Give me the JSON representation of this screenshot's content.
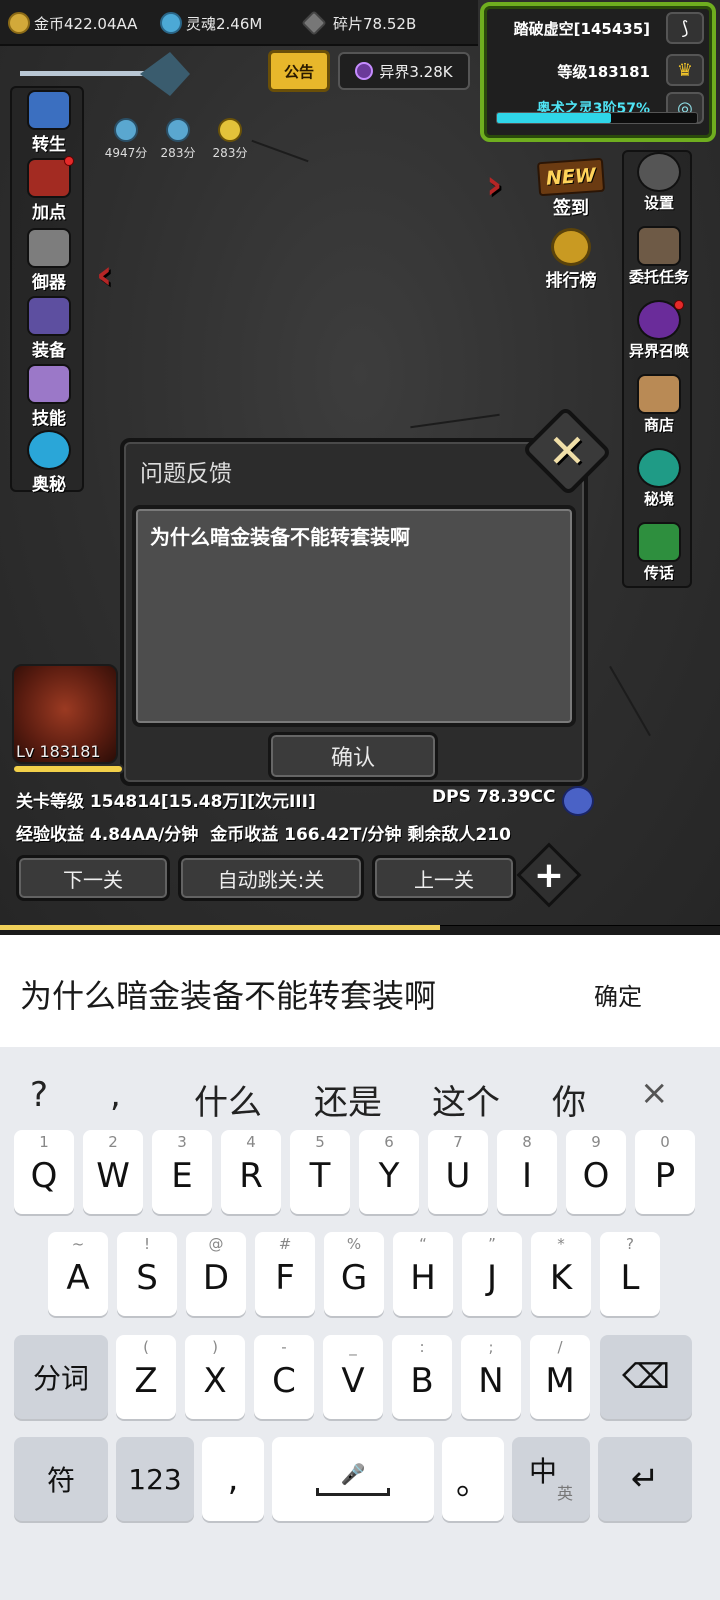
{
  "resources": {
    "gold": "金币422.04AA",
    "soul": "灵魂2.46M",
    "shard": "碎片78.52B"
  },
  "player": {
    "name": "踏破虚空[145435]",
    "level": "等级183181",
    "arcane": "奥术之灵3阶57%",
    "arcane_progress": 0.57
  },
  "top": {
    "notice": "公告",
    "otherworld": "异界3.28K"
  },
  "buffs": [
    "4947分",
    "283分",
    "283分"
  ],
  "left_menu": [
    "转生",
    "加点",
    "御器",
    "装备",
    "技能",
    "奥秘"
  ],
  "right_menu": [
    "设置",
    "委托任务",
    "异界召唤",
    "商店",
    "秘境",
    "传话"
  ],
  "checkin": {
    "tag": "NEW",
    "label": "签到"
  },
  "ranking": "排行榜",
  "dialog": {
    "title": "问题反馈",
    "text": "为什么暗金装备不能转套装啊",
    "confirm": "确认"
  },
  "hero": {
    "level": "Lv 183181"
  },
  "stats": {
    "stage": "关卡等级 154814[15.48万][次元III]",
    "dps": "DPS 78.39CC",
    "income": "经验收益 4.84AA/分钟  金币收益 166.42T/分钟 剩余敌人210"
  },
  "buttons": {
    "next": "下一关",
    "auto_skip": "自动跳关:关",
    "prev": "上一关",
    "plus": "+"
  },
  "ime": {
    "text": "为什么暗金装备不能转套装啊",
    "confirm": "确定",
    "candidates": [
      "?",
      ",",
      "什么",
      "还是",
      "这个",
      "你"
    ],
    "close": "×"
  },
  "keyboard": {
    "row1": [
      {
        "k": "Q",
        "h": "1"
      },
      {
        "k": "W",
        "h": "2"
      },
      {
        "k": "E",
        "h": "3"
      },
      {
        "k": "R",
        "h": "4"
      },
      {
        "k": "T",
        "h": "5"
      },
      {
        "k": "Y",
        "h": "6"
      },
      {
        "k": "U",
        "h": "7"
      },
      {
        "k": "I",
        "h": "8"
      },
      {
        "k": "O",
        "h": "9"
      },
      {
        "k": "P",
        "h": "0"
      }
    ],
    "row2": [
      {
        "k": "A",
        "h": "~"
      },
      {
        "k": "S",
        "h": "!"
      },
      {
        "k": "D",
        "h": "@"
      },
      {
        "k": "F",
        "h": "#"
      },
      {
        "k": "G",
        "h": "%"
      },
      {
        "k": "H",
        "h": "“"
      },
      {
        "k": "J",
        "h": "”"
      },
      {
        "k": "K",
        "h": "*"
      },
      {
        "k": "L",
        "h": "?"
      }
    ],
    "row3": [
      {
        "k": "Z",
        "h": "("
      },
      {
        "k": "X",
        "h": ")"
      },
      {
        "k": "C",
        "h": "-"
      },
      {
        "k": "V",
        "h": "_"
      },
      {
        "k": "B",
        "h": ":"
      },
      {
        "k": "N",
        "h": ";"
      },
      {
        "k": "M",
        "h": "/"
      }
    ],
    "segment": "分词",
    "symbols": "符",
    "numbers": "123",
    "comma": ",",
    "period": "。",
    "lang_main": "中",
    "lang_sub": "英",
    "backspace": "⌫",
    "enter": "↵",
    "mic": "🎤"
  }
}
